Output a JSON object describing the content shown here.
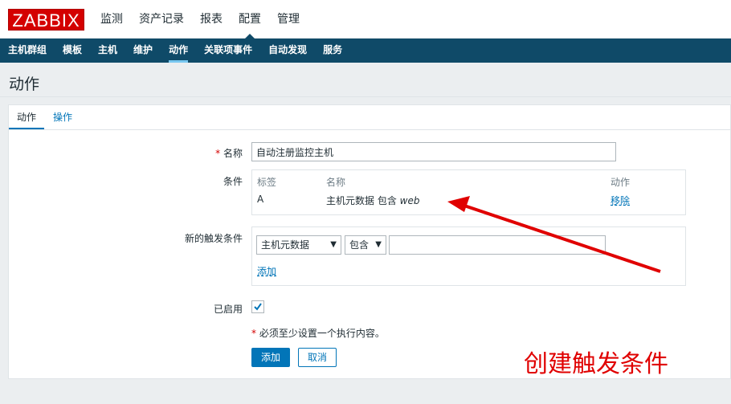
{
  "logo": "ZABBIX",
  "topnav": [
    {
      "label": "监测",
      "selected": false
    },
    {
      "label": "资产记录",
      "selected": false
    },
    {
      "label": "报表",
      "selected": false
    },
    {
      "label": "配置",
      "selected": true
    },
    {
      "label": "管理",
      "selected": false
    }
  ],
  "subnav": [
    {
      "label": "主机群组",
      "selected": false
    },
    {
      "label": "模板",
      "selected": false
    },
    {
      "label": "主机",
      "selected": false
    },
    {
      "label": "维护",
      "selected": false
    },
    {
      "label": "动作",
      "selected": true
    },
    {
      "label": "关联项事件",
      "selected": false
    },
    {
      "label": "自动发现",
      "selected": false
    },
    {
      "label": "服务",
      "selected": false
    }
  ],
  "page_title": "动作",
  "tabs": {
    "action": "动作",
    "operations": "操作"
  },
  "form": {
    "name_required_mark": "*",
    "name_label": "名称",
    "name_value": "自动注册监控主机",
    "conditions_label": "条件",
    "conditions_table": {
      "headers": {
        "tag": "标签",
        "name": "名称",
        "action": "动作"
      },
      "rows": [
        {
          "tag": "A",
          "name_prefix": "主机元数据 包含 ",
          "name_value": "web",
          "action": "移除"
        }
      ]
    },
    "new_condition_label": "新的触发条件",
    "new_condition": {
      "type_select": "主机元数据",
      "operator_select": "包含",
      "value": "",
      "add_link": "添加"
    },
    "enabled_label": "已启用",
    "enabled_checked": true,
    "required_hint_mark": "*",
    "required_hint": "必须至少设置一个执行内容。",
    "add_button": "添加",
    "cancel_button": "取消"
  },
  "annotation_text": "创建触发条件",
  "colors": {
    "brand_red": "#d40000",
    "nav_blue": "#0f4a68",
    "link_blue": "#0275b8",
    "annotation_red": "#e00000"
  }
}
